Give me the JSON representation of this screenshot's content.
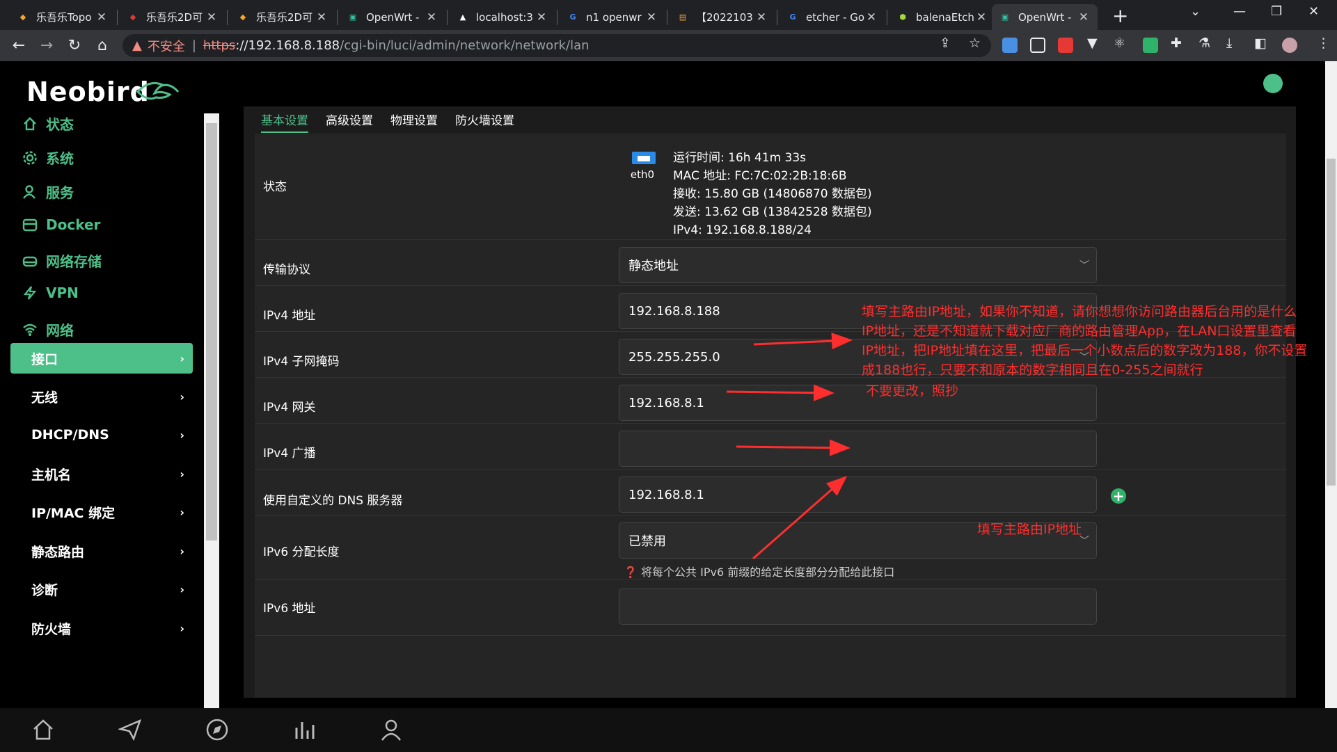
{
  "browser": {
    "tabs": [
      {
        "title": "乐吾乐Topo",
        "fav_color": "#f5a623",
        "fav": "◆"
      },
      {
        "title": "乐吾乐2D可",
        "fav_color": "#e53935",
        "fav": "◆"
      },
      {
        "title": "乐吾乐2D可",
        "fav_color": "#f5a623",
        "fav": "◆"
      },
      {
        "title": "OpenWrt -",
        "fav_color": "#35c2a0",
        "fav": "▣"
      },
      {
        "title": "localhost:3",
        "fav_color": "#fff",
        "fav": "▲"
      },
      {
        "title": "n1 openwr",
        "fav_color": "#4285f4",
        "fav": "G"
      },
      {
        "title": "【2022103",
        "fav_color": "#e8a33d",
        "fav": "▤"
      },
      {
        "title": "etcher - Go",
        "fav_color": "#4285f4",
        "fav": "G"
      },
      {
        "title": "balenaEtch",
        "fav_color": "#a5d63f",
        "fav": "⬢"
      },
      {
        "title": "OpenWrt -",
        "fav_color": "#35c2a0",
        "fav": "▣"
      }
    ],
    "url": {
      "warning": "不安全",
      "scheme": "https",
      "host": "://192.168.8.188",
      "path": "/cgi-bin/luci/admin/network/network/lan"
    }
  },
  "brand": {
    "name": "Neobird"
  },
  "sidebar": {
    "top": [
      {
        "label": "状态",
        "icon": "home-icon"
      },
      {
        "label": "系统",
        "icon": "gear-icon"
      },
      {
        "label": "服务",
        "icon": "user-icon"
      },
      {
        "label": "Docker",
        "icon": "docker-icon"
      },
      {
        "label": "网络存储",
        "icon": "storage-icon"
      },
      {
        "label": "VPN",
        "icon": "bolt-icon"
      },
      {
        "label": "网络",
        "icon": "wifi-icon"
      }
    ],
    "sub": [
      {
        "label": "接口",
        "active": true
      },
      {
        "label": "无线"
      },
      {
        "label": "DHCP/DNS"
      },
      {
        "label": "主机名"
      },
      {
        "label": "IP/MAC 绑定"
      },
      {
        "label": "静态路由"
      },
      {
        "label": "诊断"
      },
      {
        "label": "防火墙"
      }
    ]
  },
  "content": {
    "tabs": [
      "基本设置",
      "高级设置",
      "物理设置",
      "防火墙设置"
    ],
    "status": {
      "label": "状态",
      "iface": "eth0",
      "lines": [
        "运行时间: 16h 41m 33s",
        "MAC 地址: FC:7C:02:2B:18:6B",
        "接收: 15.80 GB (14806870 数据包)",
        "发送: 13.62 GB (13842528 数据包)",
        "IPv4: 192.168.8.188/24"
      ]
    },
    "fields": {
      "protocol": {
        "label": "传输协议",
        "value": "静态地址"
      },
      "ipv4_addr": {
        "label": "IPv4 地址",
        "value": "192.168.8.188"
      },
      "netmask": {
        "label": "IPv4 子网掩码",
        "value": "255.255.255.0"
      },
      "gateway": {
        "label": "IPv4 网关",
        "value": "192.168.8.1"
      },
      "broadcast": {
        "label": "IPv4 广播",
        "value": ""
      },
      "dns": {
        "label": "使用自定义的 DNS 服务器",
        "value": "192.168.8.1"
      },
      "ipv6_len": {
        "label": "IPv6 分配长度",
        "value": "已禁用",
        "hint": "将每个公共 IPv6 前缀的给定长度部分分配给此接口"
      },
      "ipv6_addr": {
        "label": "IPv6 地址",
        "value": ""
      }
    }
  },
  "annotations": {
    "ip": [
      "填写主路由IP地址，如果你不知道，请你想想你访问路由器后台用的是什么",
      "IP地址，还是不知道就下载对应厂商的路由管理App，在LAN口设置里查看",
      "IP地址，把IP地址填在这里，把最后一个小数点后的数字改为188，你不设置",
      "成188也行，只要不和原本的数字相同且在0-255之间就行"
    ],
    "mask": "不要更改，照抄",
    "gateway": "填写主路由IP地址"
  },
  "colors": {
    "accent": "#4dc08a",
    "annotation": "#ff2e2e"
  }
}
